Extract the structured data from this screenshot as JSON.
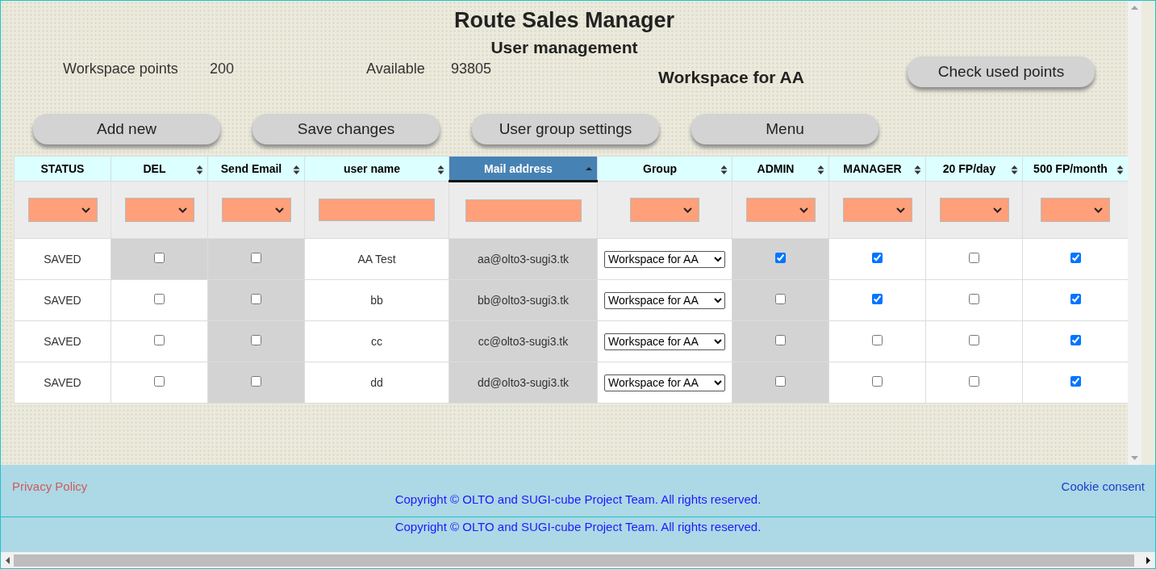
{
  "header": {
    "title": "Route Sales Manager",
    "subtitle": "User management"
  },
  "info": {
    "points_label": "Workspace points",
    "points_value": "200",
    "available_label": "Available",
    "available_value": "93805",
    "workspace_name": "Workspace for AA",
    "check_button": "Check used points"
  },
  "buttons": [
    "Add new",
    "Save changes",
    "User group settings",
    "Menu"
  ],
  "table": {
    "columns": [
      {
        "label": "STATUS",
        "sortable": false,
        "sorted": false
      },
      {
        "label": "DEL",
        "sortable": true,
        "sorted": false
      },
      {
        "label": "Send Email",
        "sortable": true,
        "sorted": false
      },
      {
        "label": "user name",
        "sortable": true,
        "sorted": false
      },
      {
        "label": "Mail address",
        "sortable": true,
        "sorted": true
      },
      {
        "label": "Group",
        "sortable": true,
        "sorted": false
      },
      {
        "label": "ADMIN",
        "sortable": true,
        "sorted": false
      },
      {
        "label": "MANAGER",
        "sortable": true,
        "sorted": false
      },
      {
        "label": "20 FP/day",
        "sortable": true,
        "sorted": false
      },
      {
        "label": "500 FP/month",
        "sortable": true,
        "sorted": false
      }
    ],
    "filters": [
      {
        "kind": "select"
      },
      {
        "kind": "select"
      },
      {
        "kind": "select"
      },
      {
        "kind": "text"
      },
      {
        "kind": "text"
      },
      {
        "kind": "select"
      },
      {
        "kind": "select"
      },
      {
        "kind": "select"
      },
      {
        "kind": "select"
      },
      {
        "kind": "select"
      }
    ],
    "rows": [
      {
        "cells": [
          {
            "kind": "text",
            "text": "SAVED",
            "disabled": false
          },
          {
            "kind": "check",
            "checked": false,
            "disabled": true
          },
          {
            "kind": "check",
            "checked": false,
            "disabled": true
          },
          {
            "kind": "text",
            "text": "AA Test",
            "disabled": false
          },
          {
            "kind": "text",
            "text": "aa@olto3-sugi3.tk",
            "disabled": true
          },
          {
            "kind": "select",
            "value": "Workspace for AA",
            "disabled": false
          },
          {
            "kind": "check",
            "checked": true,
            "disabled": true
          },
          {
            "kind": "check",
            "checked": true,
            "disabled": false
          },
          {
            "kind": "check",
            "checked": false,
            "disabled": false
          },
          {
            "kind": "check",
            "checked": true,
            "disabled": false
          }
        ]
      },
      {
        "cells": [
          {
            "kind": "text",
            "text": "SAVED",
            "disabled": false
          },
          {
            "kind": "check",
            "checked": false,
            "disabled": false
          },
          {
            "kind": "check",
            "checked": false,
            "disabled": true
          },
          {
            "kind": "text",
            "text": "bb",
            "disabled": false
          },
          {
            "kind": "text",
            "text": "bb@olto3-sugi3.tk",
            "disabled": true
          },
          {
            "kind": "select",
            "value": "Workspace for AA",
            "disabled": false
          },
          {
            "kind": "check",
            "checked": false,
            "disabled": true
          },
          {
            "kind": "check",
            "checked": true,
            "disabled": false
          },
          {
            "kind": "check",
            "checked": false,
            "disabled": false
          },
          {
            "kind": "check",
            "checked": true,
            "disabled": false
          }
        ]
      },
      {
        "cells": [
          {
            "kind": "text",
            "text": "SAVED",
            "disabled": false
          },
          {
            "kind": "check",
            "checked": false,
            "disabled": false
          },
          {
            "kind": "check",
            "checked": false,
            "disabled": true
          },
          {
            "kind": "text",
            "text": "cc",
            "disabled": false
          },
          {
            "kind": "text",
            "text": "cc@olto3-sugi3.tk",
            "disabled": true
          },
          {
            "kind": "select",
            "value": "Workspace for AA",
            "disabled": false
          },
          {
            "kind": "check",
            "checked": false,
            "disabled": true
          },
          {
            "kind": "check",
            "checked": false,
            "disabled": false
          },
          {
            "kind": "check",
            "checked": false,
            "disabled": false
          },
          {
            "kind": "check",
            "checked": true,
            "disabled": false
          }
        ]
      },
      {
        "cells": [
          {
            "kind": "text",
            "text": "SAVED",
            "disabled": false
          },
          {
            "kind": "check",
            "checked": false,
            "disabled": false
          },
          {
            "kind": "check",
            "checked": false,
            "disabled": true
          },
          {
            "kind": "text",
            "text": "dd",
            "disabled": false
          },
          {
            "kind": "text",
            "text": "dd@olto3-sugi3.tk",
            "disabled": true
          },
          {
            "kind": "select",
            "value": "Workspace for AA",
            "disabled": false
          },
          {
            "kind": "check",
            "checked": false,
            "disabled": true
          },
          {
            "kind": "check",
            "checked": false,
            "disabled": false
          },
          {
            "kind": "check",
            "checked": false,
            "disabled": false
          },
          {
            "kind": "check",
            "checked": true,
            "disabled": false
          }
        ]
      }
    ]
  },
  "footer": {
    "privacy": "Privacy Policy",
    "cookie": "Cookie consent",
    "copyright": [
      "Copyright © OLTO and SUGI-cube Project Team. All rights reserved.",
      "Copyright © OLTO and SUGI-cube Project Team. All rights reserved."
    ]
  }
}
